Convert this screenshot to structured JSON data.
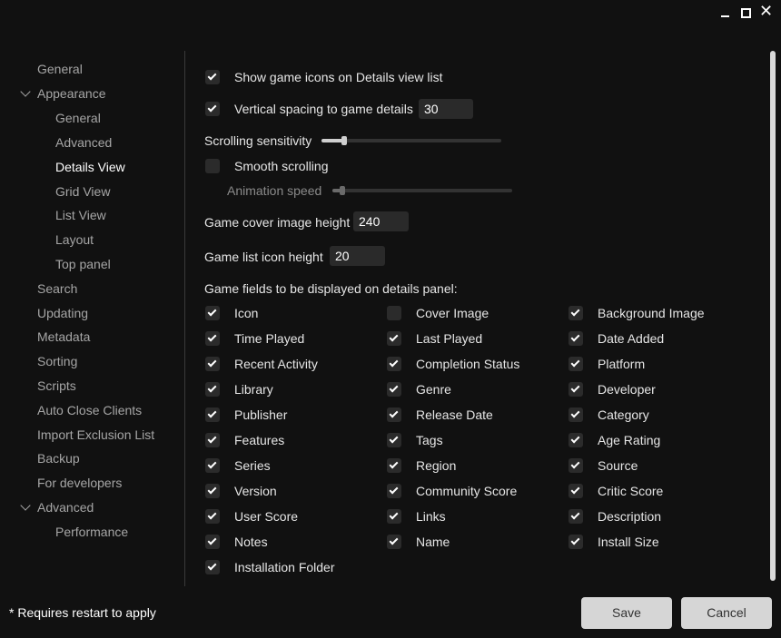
{
  "nav": {
    "general": "General",
    "appearance": "Appearance",
    "appearance_general": "General",
    "appearance_advanced": "Advanced",
    "details_view": "Details View",
    "grid_view": "Grid View",
    "list_view": "List View",
    "layout": "Layout",
    "top_panel": "Top panel",
    "search": "Search",
    "updating": "Updating",
    "metadata": "Metadata",
    "sorting": "Sorting",
    "scripts": "Scripts",
    "auto_close_clients": "Auto Close Clients",
    "import_exclusion_list": "Import Exclusion List",
    "backup": "Backup",
    "for_developers": "For developers",
    "advanced": "Advanced",
    "performance": "Performance",
    "selected": "Details View"
  },
  "settings": {
    "show_icons": {
      "label": "Show game icons on Details view list",
      "checked": true
    },
    "vertical_spacing": {
      "label": "Vertical spacing to game details",
      "checked": true,
      "value": "30"
    },
    "scrolling_sensitivity": {
      "label": "Scrolling sensitivity",
      "level": 0.12
    },
    "smooth_scrolling": {
      "label": "Smooth scrolling",
      "checked": false
    },
    "animation_speed": {
      "label": "Animation speed",
      "level": 0.05
    },
    "cover_height": {
      "label": "Game cover image height",
      "value": "240"
    },
    "icon_height": {
      "label": "Game list icon height",
      "value": "20"
    },
    "fields_heading": "Game fields to be displayed on details panel:"
  },
  "fields": [
    {
      "label": "Icon",
      "checked": true
    },
    {
      "label": "Cover Image",
      "checked": false
    },
    {
      "label": "Background Image",
      "checked": true
    },
    {
      "label": "Time Played",
      "checked": true
    },
    {
      "label": "Last Played",
      "checked": true
    },
    {
      "label": "Date Added",
      "checked": true
    },
    {
      "label": "Recent Activity",
      "checked": true
    },
    {
      "label": "Completion Status",
      "checked": true
    },
    {
      "label": "Platform",
      "checked": true
    },
    {
      "label": "Library",
      "checked": true
    },
    {
      "label": "Genre",
      "checked": true
    },
    {
      "label": "Developer",
      "checked": true
    },
    {
      "label": "Publisher",
      "checked": true
    },
    {
      "label": "Release Date",
      "checked": true
    },
    {
      "label": "Category",
      "checked": true
    },
    {
      "label": "Features",
      "checked": true
    },
    {
      "label": "Tags",
      "checked": true
    },
    {
      "label": "Age Rating",
      "checked": true
    },
    {
      "label": "Series",
      "checked": true
    },
    {
      "label": "Region",
      "checked": true
    },
    {
      "label": "Source",
      "checked": true
    },
    {
      "label": "Version",
      "checked": true
    },
    {
      "label": "Community Score",
      "checked": true
    },
    {
      "label": "Critic Score",
      "checked": true
    },
    {
      "label": "User Score",
      "checked": true
    },
    {
      "label": "Links",
      "checked": true
    },
    {
      "label": "Description",
      "checked": true
    },
    {
      "label": "Notes",
      "checked": true
    },
    {
      "label": "Name",
      "checked": true
    },
    {
      "label": "Install Size",
      "checked": true
    },
    {
      "label": "Installation Folder",
      "checked": true
    }
  ],
  "footer": {
    "note": "* Requires restart to apply",
    "save": "Save",
    "cancel": "Cancel"
  },
  "icons": {
    "minimize": "minimize-icon",
    "maximize": "maximize-icon",
    "close": "close-icon",
    "check": "checkmark-icon",
    "chevron": "chevron-down-icon"
  }
}
